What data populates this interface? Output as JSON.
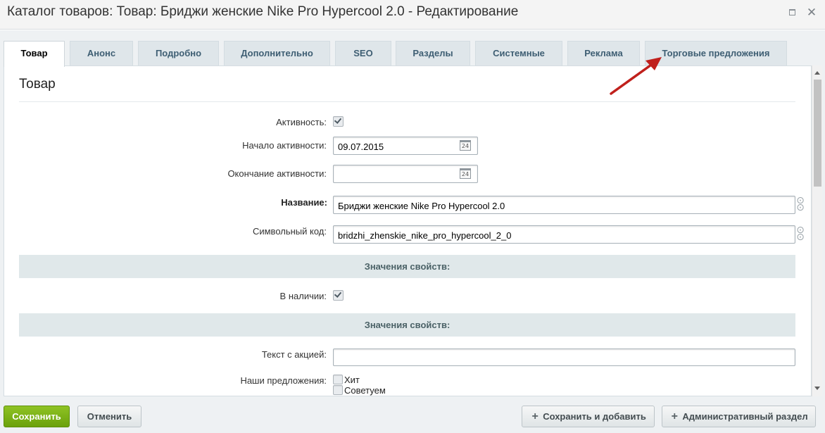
{
  "window": {
    "title": "Каталог товаров: Товар: Бриджи женские Nike Pro Hypercool 2.0 - Редактирование"
  },
  "tabs": [
    {
      "label": "Товар",
      "active": true
    },
    {
      "label": "Анонс"
    },
    {
      "label": "Подробно"
    },
    {
      "label": "Дополнительно"
    },
    {
      "label": "SEO"
    },
    {
      "label": "Разделы"
    },
    {
      "label": "Системные"
    },
    {
      "label": "Реклама"
    },
    {
      "label": "Торговые предложения"
    }
  ],
  "section": {
    "title": "Товар"
  },
  "fields": {
    "active": {
      "label": "Активность:",
      "checked": true
    },
    "active_from": {
      "label": "Начало активности:",
      "value": "09.07.2015"
    },
    "active_to": {
      "label": "Окончание активности:",
      "value": ""
    },
    "name": {
      "label": "Название:",
      "value": "Бриджи женские Nike Pro Hypercool 2.0"
    },
    "code": {
      "label": "Символьный код:",
      "value": "bridzhi_zhenskie_nike_pro_hypercool_2_0"
    },
    "props_header_1": "Значения свойств:",
    "in_stock": {
      "label": "В наличии:",
      "checked": true
    },
    "props_header_2": "Значения свойств:",
    "promo_text": {
      "label": "Текст с акцией:",
      "value": ""
    },
    "offers": {
      "label": "Наши предложения:",
      "options": [
        "Хит",
        "Советуем"
      ]
    }
  },
  "calendar_icon_text": "24",
  "buttons": {
    "save": "Сохранить",
    "cancel": "Отменить",
    "save_add": "Сохранить и добавить",
    "admin": "Административный раздел"
  },
  "colors": {
    "save_button": "#7bb116",
    "arrow": "#c0201c",
    "tab_text": "#3e5e73"
  }
}
